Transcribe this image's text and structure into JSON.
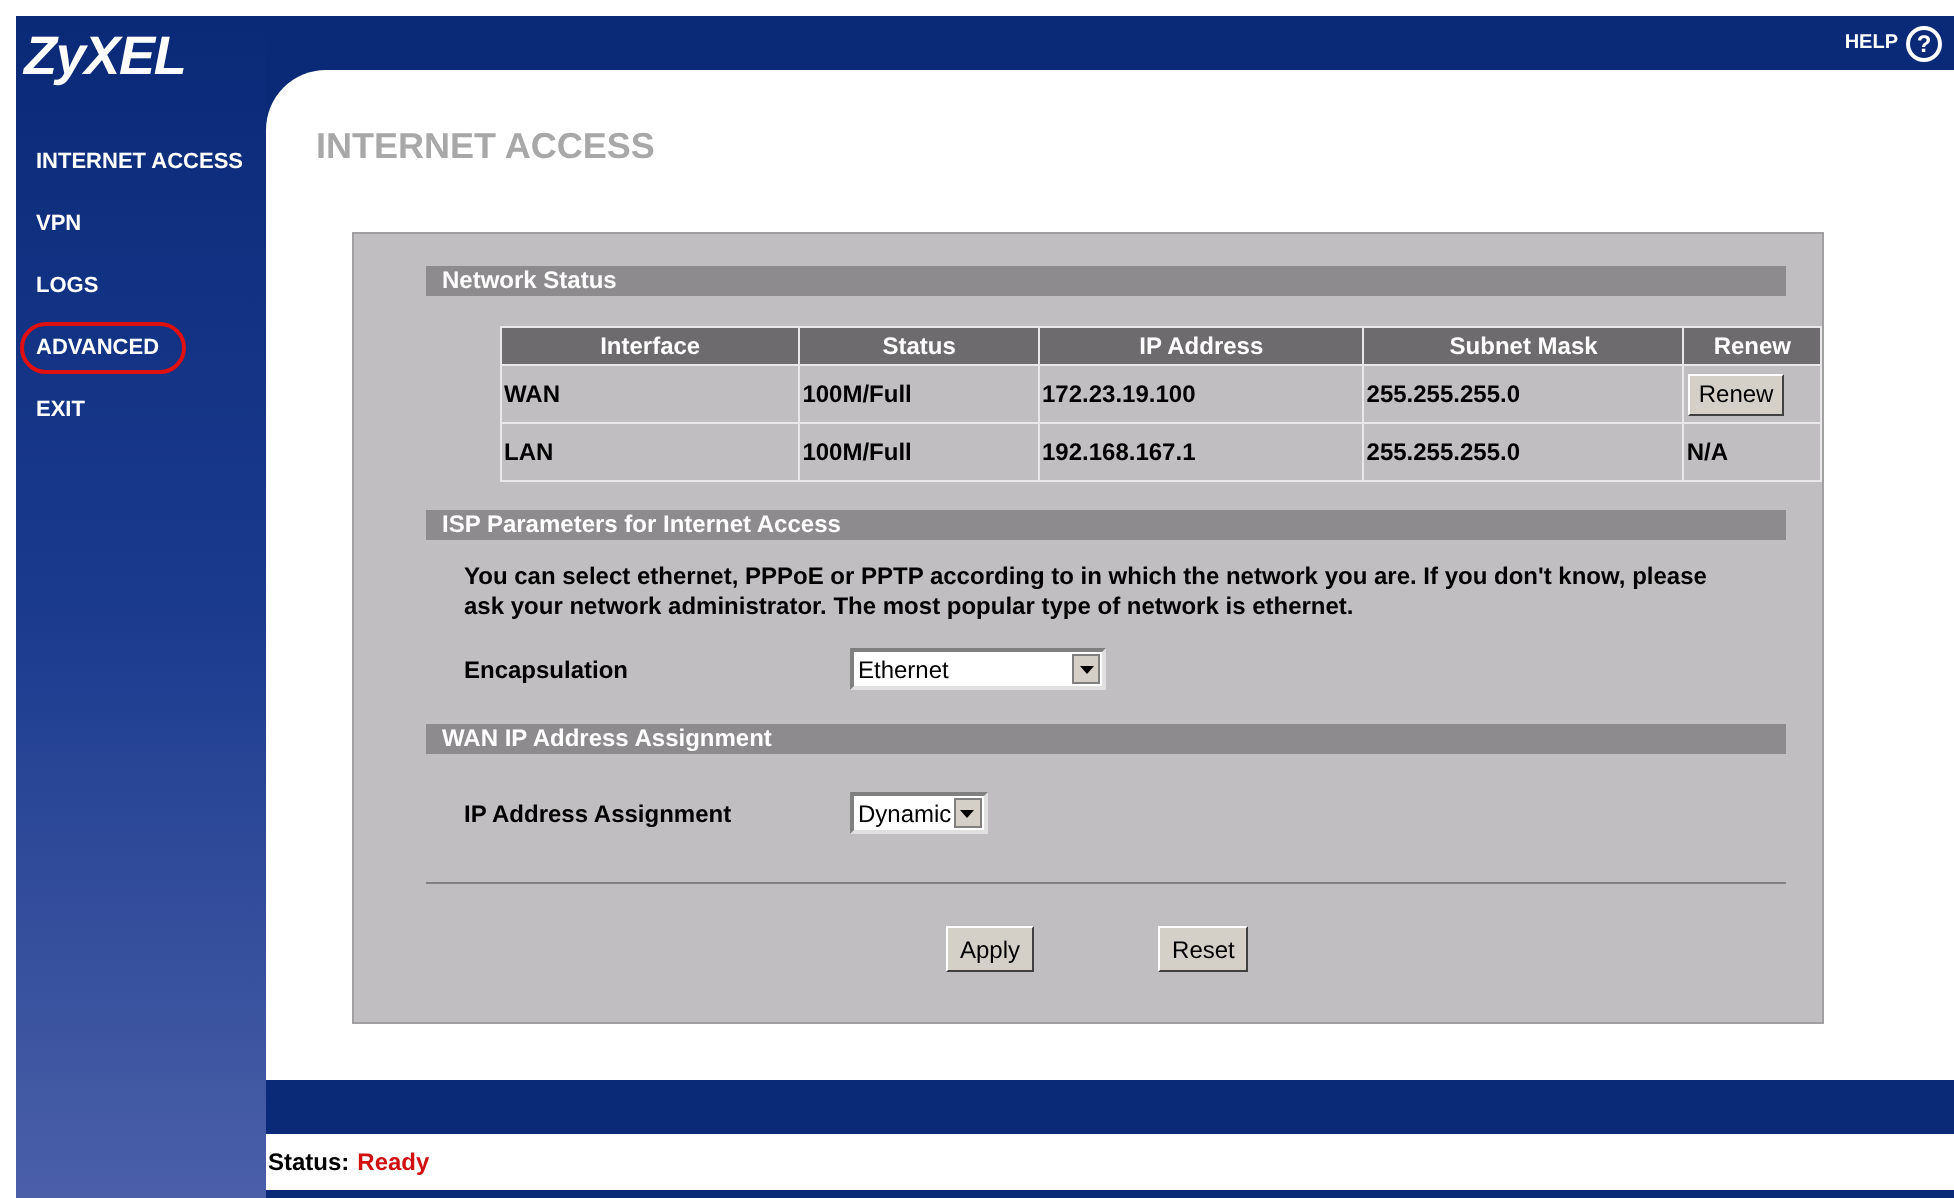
{
  "logo": "ZyXEL",
  "help": {
    "label": "HELP",
    "icon_text": "?"
  },
  "sidebar": {
    "items": [
      {
        "label": "INTERNET ACCESS",
        "circled": false
      },
      {
        "label": "VPN",
        "circled": false
      },
      {
        "label": "LOGS",
        "circled": false
      },
      {
        "label": "ADVANCED",
        "circled": true
      },
      {
        "label": "EXIT",
        "circled": false
      }
    ]
  },
  "page_title": "INTERNET ACCESS",
  "network_status": {
    "heading": "Network Status",
    "columns": [
      "Interface",
      "Status",
      "IP Address",
      "Subnet Mask",
      "Renew"
    ],
    "rows": [
      {
        "interface": "WAN",
        "status": "100M/Full",
        "ip_address": "172.23.19.100",
        "subnet_mask": "255.255.255.0",
        "renew": {
          "kind": "button",
          "label": "Renew"
        }
      },
      {
        "interface": "LAN",
        "status": "100M/Full",
        "ip_address": "192.168.167.1",
        "subnet_mask": "255.255.255.0",
        "renew": {
          "kind": "text",
          "label": "N/A"
        }
      }
    ]
  },
  "isp": {
    "heading": "ISP Parameters for Internet Access",
    "description": "You can select ethernet, PPPoE or PPTP according to in which the network you are. If you don't know, please ask your network administrator. The most popular type of network is ethernet.",
    "encapsulation": {
      "label": "Encapsulation",
      "value": "Ethernet"
    }
  },
  "wan_ip": {
    "heading": "WAN IP Address Assignment",
    "assignment": {
      "label": "IP Address Assignment",
      "value": "Dynamic"
    }
  },
  "buttons": [
    "Apply",
    "Reset"
  ],
  "status_bar": {
    "label": "Status:",
    "value": "Ready"
  }
}
